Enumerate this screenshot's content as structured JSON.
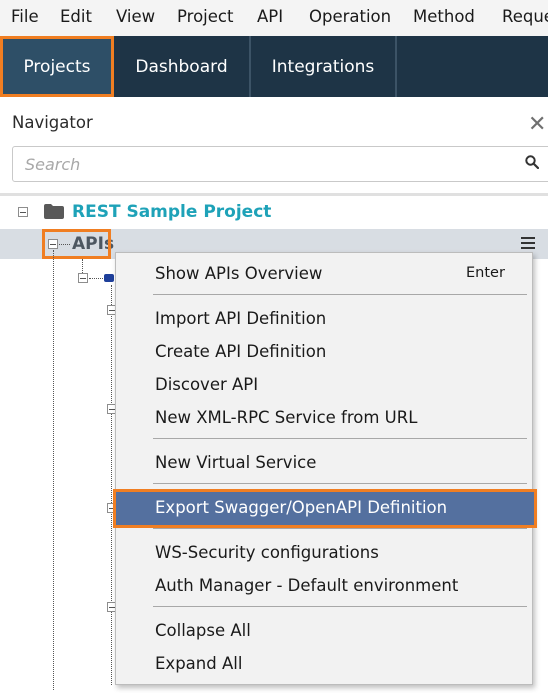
{
  "menubar": {
    "items": [
      "File",
      "Edit",
      "View",
      "Project",
      "API",
      "Operation",
      "Method",
      "Reque"
    ]
  },
  "tabs": [
    {
      "label": "Projects",
      "active": true
    },
    {
      "label": "Dashboard",
      "active": false
    },
    {
      "label": "Integrations",
      "active": false
    }
  ],
  "navigator": {
    "title": "Navigator",
    "close_glyph": "✕",
    "search_placeholder": "Search"
  },
  "tree": {
    "root_label": "REST Sample Project",
    "apis_label": "APIs"
  },
  "context_menu": {
    "groups": [
      [
        {
          "label": "Show APIs Overview",
          "shortcut": "Enter"
        }
      ],
      [
        {
          "label": "Import API Definition"
        },
        {
          "label": "Create API Definition"
        },
        {
          "label": "Discover API"
        },
        {
          "label": "New XML-RPC Service from URL"
        }
      ],
      [
        {
          "label": "New Virtual Service"
        }
      ],
      [
        {
          "label": "Export Swagger/OpenAPI Definition",
          "selected": true
        }
      ],
      [
        {
          "label": "WS-Security configurations"
        },
        {
          "label": "Auth Manager - Default environment"
        }
      ],
      [
        {
          "label": "Collapse All"
        },
        {
          "label": "Expand All"
        }
      ]
    ]
  },
  "colors": {
    "tabbar_bg": "#1e3446",
    "active_tab_bg": "#2e4f67",
    "highlight_orange": "#f07e22",
    "selected_item_bg": "#54709f",
    "root_label": "#1ea2b8"
  },
  "icons": {
    "folder": "folder-icon",
    "search": "search-icon",
    "close": "close-icon",
    "menu": "hamburger-menu-icon"
  }
}
